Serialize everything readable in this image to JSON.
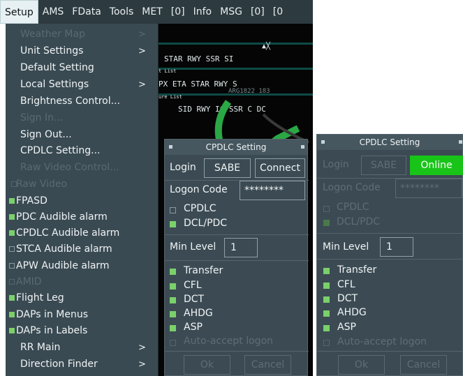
{
  "menubar": {
    "items": [
      "Setup",
      "AMS",
      "FData",
      "Tools",
      "MET",
      "[0]",
      "Info",
      "MSG",
      "[0]",
      "[0"
    ]
  },
  "setup_menu": {
    "items": [
      {
        "label": "Weather Map",
        "arrow": ">",
        "state": "disabled"
      },
      {
        "label": "Unit Settings",
        "arrow": ">",
        "state": "normal"
      },
      {
        "label": "Default Setting",
        "arrow": "",
        "state": "normal"
      },
      {
        "label": "Local Settings",
        "arrow": ">",
        "state": "normal"
      },
      {
        "label": "Brightness Control...",
        "arrow": "",
        "state": "normal"
      },
      {
        "label": "Sign In...",
        "arrow": "",
        "state": "disabled"
      },
      {
        "label": "Sign Out...",
        "arrow": "",
        "state": "normal"
      },
      {
        "label": "CPDLC Setting...",
        "arrow": "",
        "state": "normal"
      },
      {
        "label": "Raw Video Control...",
        "arrow": "",
        "state": "disabled"
      },
      {
        "label": "Raw Video",
        "check": "dis",
        "state": "disabled"
      },
      {
        "label": "FPASD",
        "check": "on",
        "state": "normal"
      },
      {
        "label": "PDC Audible alarm",
        "check": "on",
        "state": "normal"
      },
      {
        "label": "CPDLC Audible alarm",
        "check": "on",
        "state": "normal"
      },
      {
        "label": "STCA Audible alarm",
        "check": "off",
        "state": "normal"
      },
      {
        "label": "APW Audible alarm",
        "check": "off",
        "state": "normal"
      },
      {
        "label": "AMID",
        "check": "dis",
        "state": "disabled"
      },
      {
        "label": "Flight Leg",
        "check": "on",
        "state": "normal"
      },
      {
        "label": "DAPs in Menus",
        "check": "on",
        "state": "normal"
      },
      {
        "label": "DAPs in Labels",
        "check": "on",
        "state": "normal"
      },
      {
        "label": "RR Main",
        "arrow": ">",
        "state": "normal"
      },
      {
        "label": "Direction Finder",
        "arrow": ">",
        "state": "normal"
      }
    ]
  },
  "radar": {
    "line1": "STAR   RWY  SSR  SI",
    "line2_label": "t List",
    "line3": "PX  ETA     STAR    RWY   S",
    "line4": "ARG1822 183",
    "line5_label": "ure List",
    "line6": "SID     RWY  IC  SSR C DC",
    "close_mark": "▲╳"
  },
  "dialog1": {
    "title": "CPDLC Setting",
    "login_label": "Login",
    "login_value": "SABE",
    "connect_label": "Connect",
    "logon_code_label": "Logon Code",
    "logon_code_value": "********",
    "cpdlc_label": "CPDLC",
    "dcl_label": "DCL/PDC",
    "min_level_label": "Min Level",
    "min_level_value": "1",
    "transfer_label": "Transfer",
    "cfl_label": "CFL",
    "dct_label": "DCT",
    "ahdg_label": "AHDG",
    "asp_label": "ASP",
    "auto_accept_label": "Auto-accept logon",
    "ok_label": "Ok",
    "cancel_label": "Cancel"
  },
  "dialog2": {
    "title": "CPDLC Setting",
    "login_label": "Login",
    "login_value": "SABE",
    "online_label": "Online",
    "logon_code_label": "Logon Code",
    "logon_code_value": "********",
    "cpdlc_label": "CPDLC",
    "dcl_label": "DCL/PDC",
    "min_level_label": "Min Level",
    "min_level_value": "1",
    "transfer_label": "Transfer",
    "cfl_label": "CFL",
    "dct_label": "DCT",
    "ahdg_label": "AHDG",
    "asp_label": "ASP",
    "auto_accept_label": "Auto-accept logon",
    "ok_label": "Ok",
    "cancel_label": "Cancel"
  },
  "colors": {
    "menu_bg": "#3a4a52",
    "menubar_bg": "#2d3a3f",
    "check_on": "#7ad06b",
    "online_green": "#19c419",
    "dialog_bg": "#3c4b53"
  }
}
